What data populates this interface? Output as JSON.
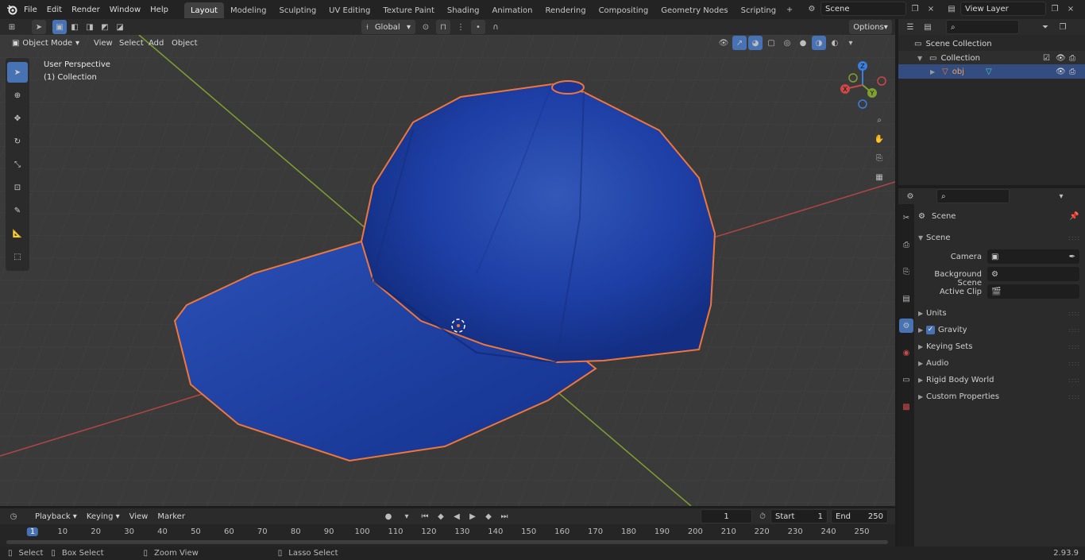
{
  "topbar": {
    "menus": [
      "File",
      "Edit",
      "Render",
      "Window",
      "Help"
    ],
    "workspaces": [
      "Layout",
      "Modeling",
      "Sculpting",
      "UV Editing",
      "Texture Paint",
      "Shading",
      "Animation",
      "Rendering",
      "Compositing",
      "Geometry Nodes",
      "Scripting"
    ],
    "active_workspace": "Layout",
    "scene_field": "Scene",
    "view_layer_field": "View Layer"
  },
  "viewport": {
    "mode": "Object Mode",
    "menus": [
      "View",
      "Select",
      "Add",
      "Object"
    ],
    "transform_orientation": "Global",
    "options_label": "Options",
    "overlay_title": "User Perspective",
    "overlay_subtitle": "(1) Collection",
    "gizmo_axes": [
      "X",
      "Y",
      "Z"
    ]
  },
  "outliner": {
    "root": "Scene Collection",
    "collection": "Collection",
    "object": "obj"
  },
  "properties": {
    "context_title": "Scene",
    "panel_title": "Scene",
    "fields": [
      {
        "label": "Camera"
      },
      {
        "label": "Background Scene"
      },
      {
        "label": "Active Clip"
      }
    ],
    "subpanels": [
      "Units",
      "Gravity",
      "Keying Sets",
      "Audio",
      "Rigid Body World",
      "Custom Properties"
    ],
    "gravity_checked": true
  },
  "timeline": {
    "menus": [
      "Playback",
      "Keying",
      "View",
      "Marker"
    ],
    "current_frame": "1",
    "start_label": "Start",
    "start_value": "1",
    "end_label": "End",
    "end_value": "250",
    "ruler_marks": [
      "1",
      "10",
      "20",
      "30",
      "40",
      "50",
      "60",
      "70",
      "80",
      "90",
      "100",
      "110",
      "120",
      "130",
      "140",
      "150",
      "160",
      "170",
      "180",
      "190",
      "200",
      "210",
      "220",
      "230",
      "240",
      "250"
    ]
  },
  "statusbar": {
    "select": "Select",
    "box_select": "Box Select",
    "zoom_view": "Zoom View",
    "lasso_select": "Lasso Select",
    "version": "2.93.9"
  },
  "colors": {
    "accent": "#4772b3",
    "selection_outline": "#f0763a",
    "x_axis": "#c94848",
    "y_axis": "#7ea030",
    "z_axis": "#3c7ee0",
    "cap": "#1f3fa8"
  }
}
